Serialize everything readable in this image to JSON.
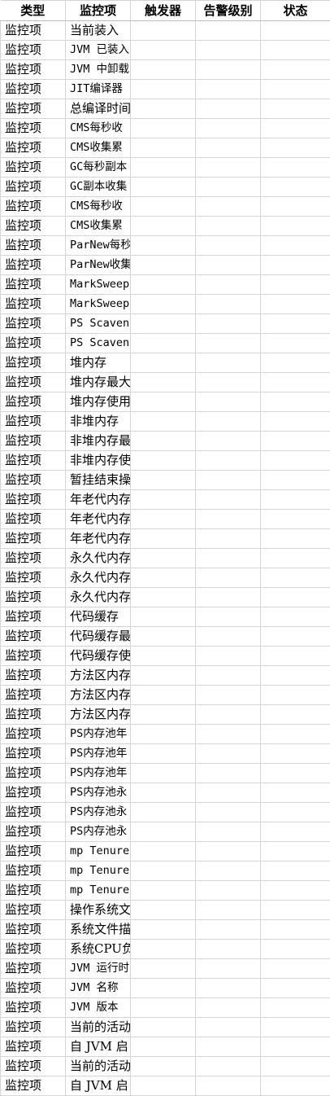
{
  "header": {
    "type": "类型",
    "item": "监控项",
    "trigger": "触发器",
    "alert_level": "告警级别",
    "status": "状态"
  },
  "rows": [
    {
      "type": "监控项",
      "item": "当前装入"
    },
    {
      "type": "监控项",
      "item": "JVM 已装入"
    },
    {
      "type": "监控项",
      "item": "JVM 中卸载"
    },
    {
      "type": "监控项",
      "item": "JIT编译器"
    },
    {
      "type": "监控项",
      "item": "总编译时间"
    },
    {
      "type": "监控项",
      "item": "CMS每秒收"
    },
    {
      "type": "监控项",
      "item": "CMS收集累"
    },
    {
      "type": "监控项",
      "item": "GC每秒副本"
    },
    {
      "type": "监控项",
      "item": "GC副本收集"
    },
    {
      "type": "监控项",
      "item": "CMS每秒收"
    },
    {
      "type": "监控项",
      "item": "CMS收集累"
    },
    {
      "type": "监控项",
      "item": "ParNew每秒"
    },
    {
      "type": "监控项",
      "item": "ParNew收集"
    },
    {
      "type": "监控项",
      "item": "MarkSweep"
    },
    {
      "type": "监控项",
      "item": "MarkSweep"
    },
    {
      "type": "监控项",
      "item": "PS Scaven"
    },
    {
      "type": "监控项",
      "item": "PS Scaven"
    },
    {
      "type": "监控项",
      "item": "堆内存"
    },
    {
      "type": "监控项",
      "item": "堆内存最大"
    },
    {
      "type": "监控项",
      "item": "堆内存使用"
    },
    {
      "type": "监控项",
      "item": "非堆内存"
    },
    {
      "type": "监控项",
      "item": "非堆内存最"
    },
    {
      "type": "监控项",
      "item": "非堆内存使"
    },
    {
      "type": "监控项",
      "item": "暂挂结束操"
    },
    {
      "type": "监控项",
      "item": "年老代内存"
    },
    {
      "type": "监控项",
      "item": "年老代内存"
    },
    {
      "type": "监控项",
      "item": "年老代内存"
    },
    {
      "type": "监控项",
      "item": "永久代内存"
    },
    {
      "type": "监控项",
      "item": "永久代内存"
    },
    {
      "type": "监控项",
      "item": "永久代内存"
    },
    {
      "type": "监控项",
      "item": "代码缓存"
    },
    {
      "type": "监控项",
      "item": "代码缓存最"
    },
    {
      "type": "监控项",
      "item": "代码缓存使"
    },
    {
      "type": "监控项",
      "item": "方法区内存"
    },
    {
      "type": "监控项",
      "item": "方法区内存"
    },
    {
      "type": "监控项",
      "item": "方法区内存"
    },
    {
      "type": "监控项",
      "item": "PS内存池年"
    },
    {
      "type": "监控项",
      "item": "PS内存池年"
    },
    {
      "type": "监控项",
      "item": "PS内存池年"
    },
    {
      "type": "监控项",
      "item": "PS内存池永"
    },
    {
      "type": "监控项",
      "item": "PS内存池永"
    },
    {
      "type": "监控项",
      "item": "PS内存池永"
    },
    {
      "type": "监控项",
      "item": "mp Tenure"
    },
    {
      "type": "监控项",
      "item": "mp Tenure"
    },
    {
      "type": "监控项",
      "item": "mp Tenure"
    },
    {
      "type": "监控项",
      "item": "操作系统文"
    },
    {
      "type": "监控项",
      "item": "系统文件描"
    },
    {
      "type": "监控项",
      "item": "系统CPU负"
    },
    {
      "type": "监控项",
      "item": "JVM 运行时"
    },
    {
      "type": "监控项",
      "item": "JVM 名称"
    },
    {
      "type": "监控项",
      "item": "JVM 版本"
    },
    {
      "type": "监控项",
      "item": "当前的活动"
    },
    {
      "type": "监控项",
      "item": "自 JVM 启"
    },
    {
      "type": "监控项",
      "item": "当前的活动"
    },
    {
      "type": "监控项",
      "item": "自 JVM 启"
    }
  ]
}
